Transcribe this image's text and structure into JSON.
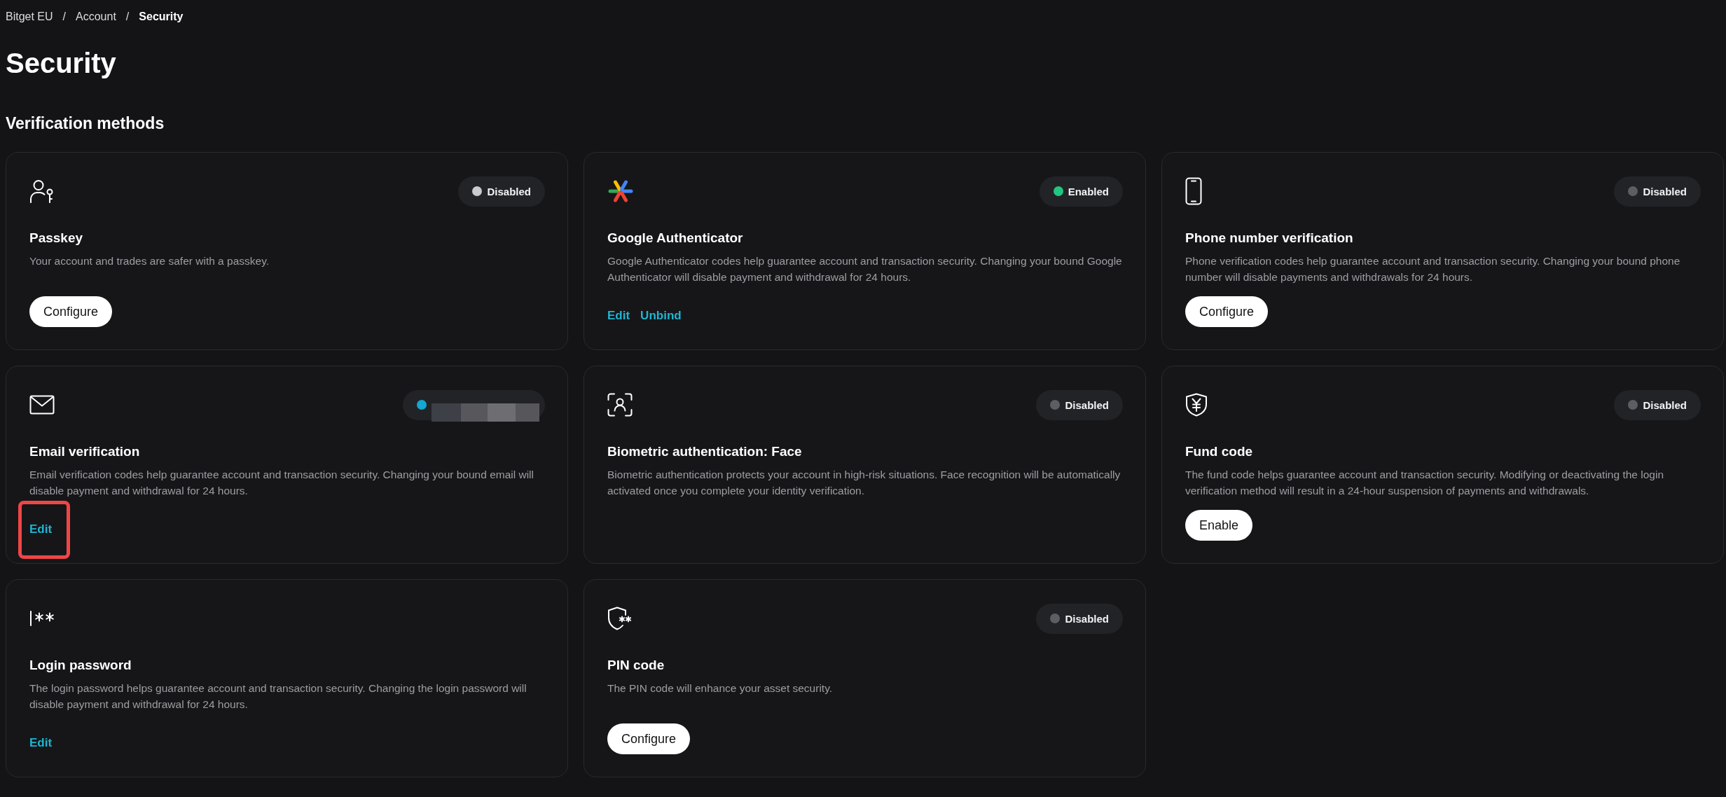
{
  "breadcrumb": [
    {
      "label": "Bitget EU",
      "current": false,
      "separator": "/"
    },
    {
      "label": "Account",
      "current": false,
      "separator": "/"
    },
    {
      "label": "Security",
      "current": true
    }
  ],
  "page_title": "Security",
  "section_title": "Verification methods",
  "cards": [
    {
      "title": "Passkey",
      "description": "Your account and trades are safer with a passkey.",
      "status": {
        "kind": "label",
        "label": "Disabled",
        "color": "#c9cacd"
      },
      "actions": [
        {
          "kind": "button",
          "label": "Configure",
          "highlighted": false
        }
      ]
    },
    {
      "title": "Google Authenticator",
      "description": "Google Authenticator codes help guarantee account and transaction security. Changing your bound Google Authenticator will disable payment and withdrawal for 24 hours.",
      "status": {
        "kind": "label",
        "label": "Enabled",
        "color": "#20c77f"
      },
      "actions": [
        {
          "kind": "link",
          "label": "Edit",
          "highlighted": false
        },
        {
          "kind": "link",
          "label": "Unbind",
          "highlighted": false
        }
      ]
    },
    {
      "title": "Phone number verification",
      "description": "Phone verification codes help guarantee account and transaction security. Changing your bound phone number will disable payments and withdrawals for 24 hours.",
      "status": {
        "kind": "label",
        "label": "Disabled",
        "color": "#5d5e63"
      },
      "actions": [
        {
          "kind": "button",
          "label": "Configure",
          "highlighted": false
        }
      ]
    },
    {
      "title": "Email verification",
      "description": "Email verification codes help guarantee account and transaction security. Changing your bound email will disable payment and withdrawal for 24 hours.",
      "status": {
        "kind": "masked",
        "color": "#14a7d0"
      },
      "actions": [
        {
          "kind": "link",
          "label": "Edit",
          "highlighted": true
        }
      ]
    },
    {
      "title": "Biometric authentication: Face",
      "description": "Biometric authentication protects your account in high-risk situations. Face recognition will be automatically activated once you complete your identity verification.",
      "status": {
        "kind": "label",
        "label": "Disabled",
        "color": "#5d5e63"
      }
    },
    {
      "title": "Fund code",
      "description": "The fund code helps guarantee account and transaction security. Modifying or deactivating the login verification method will result in a 24-hour suspension of payments and withdrawals.",
      "status": {
        "kind": "label",
        "label": "Disabled",
        "color": "#5d5e63"
      },
      "actions": [
        {
          "kind": "button",
          "label": "Enable",
          "highlighted": false
        }
      ]
    },
    {
      "title": "Login password",
      "description": "The login password helps guarantee account and transaction security. Changing the login password will disable payment and withdrawal for 24 hours.",
      "actions": [
        {
          "kind": "link",
          "label": "Edit",
          "highlighted": false
        }
      ]
    },
    {
      "title": "PIN code",
      "description": "The PIN code will enhance your asset security.",
      "status": {
        "kind": "label",
        "label": "Disabled",
        "color": "#5d5e63"
      },
      "actions": [
        {
          "kind": "button",
          "label": "Configure",
          "highlighted": false
        }
      ]
    }
  ]
}
